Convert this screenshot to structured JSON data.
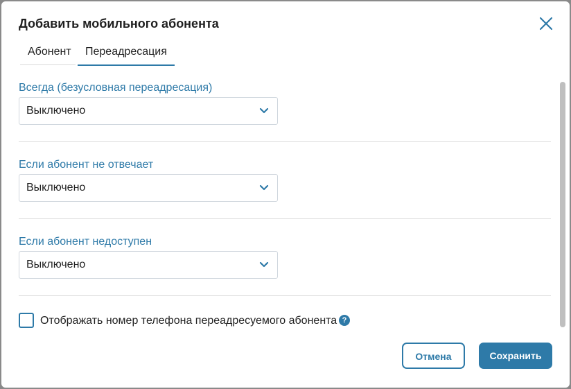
{
  "dialog": {
    "title": "Добавить мобильного абонента"
  },
  "tabs": [
    {
      "label": "Абонент",
      "active": false
    },
    {
      "label": "Переадресация",
      "active": true
    }
  ],
  "forwarding": {
    "always": {
      "label": "Всегда (безусловная переадресация)",
      "value": "Выключено"
    },
    "no_answer": {
      "label": "Если абонент не отвечает",
      "value": "Выключено"
    },
    "unavailable": {
      "label": "Если абонент недоступен",
      "value": "Выключено"
    }
  },
  "show_number": {
    "label": "Отображать номер телефона переадресуемого абонента",
    "checked": false,
    "help_icon": "?"
  },
  "buttons": {
    "cancel": "Отмена",
    "save": "Сохранить"
  },
  "colors": {
    "accent": "#2e7aa8",
    "text": "#222222"
  }
}
